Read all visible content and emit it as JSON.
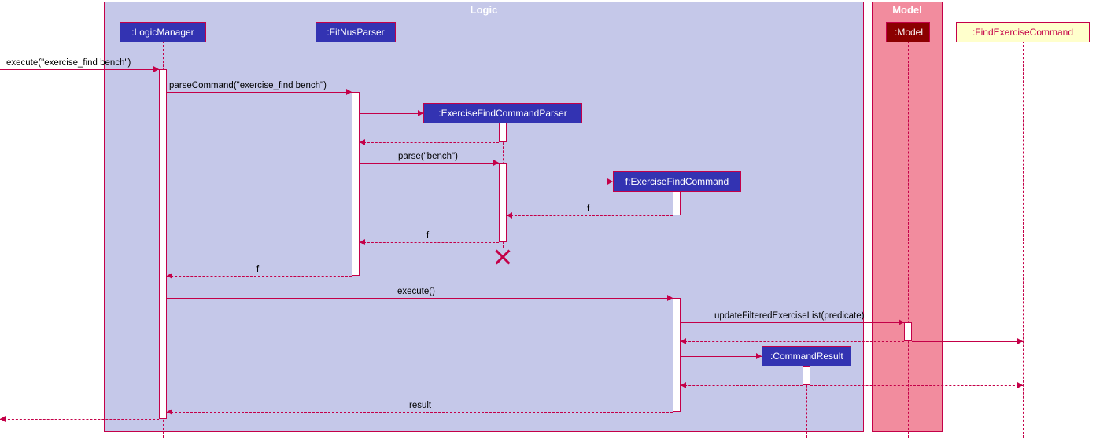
{
  "boxes": {
    "logic": "Logic",
    "model": "Model"
  },
  "participants": {
    "logicManager": ":LogicManager",
    "fitNusParser": ":FitNusParser",
    "exerciseFindCommandParser": ":ExerciseFindCommandParser",
    "exerciseFindCommand": "f:ExerciseFindCommand",
    "commandResult": ":CommandResult",
    "model": ":Model",
    "findExerciseCommand": ":FindExerciseCommand"
  },
  "messages": {
    "execute1": "execute(\"exercise_find bench\")",
    "parseCommand": "parseCommand(\"exercise_find bench\")",
    "parse": "parse(\"bench\")",
    "f1": "f",
    "f2": "f",
    "f3": "f",
    "execute2": "execute()",
    "updateFiltered": "updateFilteredExerciseList(predicate)",
    "result": "result"
  }
}
